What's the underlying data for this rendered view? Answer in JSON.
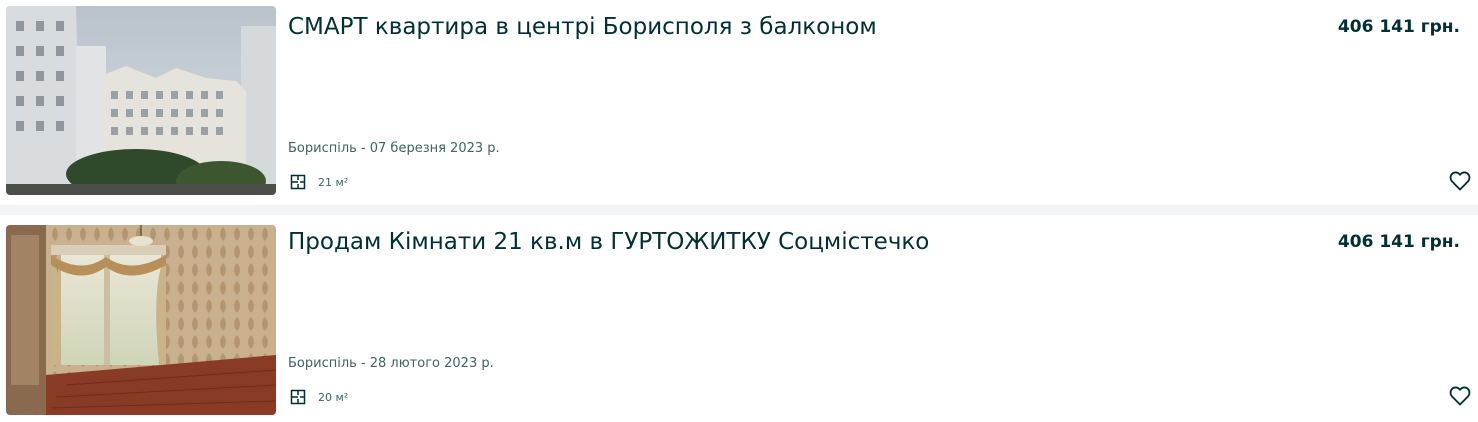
{
  "listings": [
    {
      "title": "СМАРТ квартира в центрі Борисполя з балконом",
      "price": "406 141 грн.",
      "location_date": "Бориспіль - 07 березня 2023 р.",
      "area": "21 м²",
      "area_icon": "floor-plan-icon",
      "favorite_icon": "heart-icon"
    },
    {
      "title": "Продам Кімнати 21 кв.м в ГУРТОЖИТКУ Соцмістечко",
      "price": "406 141 грн.",
      "location_date": "Бориспіль - 28 лютого 2023 р.",
      "area": "20 м²",
      "area_icon": "floor-plan-icon",
      "favorite_icon": "heart-icon"
    }
  ],
  "colors": {
    "text_primary": "#002f34",
    "text_secondary": "#406367",
    "page_background": "#f2f4f5",
    "card_background": "#ffffff"
  }
}
